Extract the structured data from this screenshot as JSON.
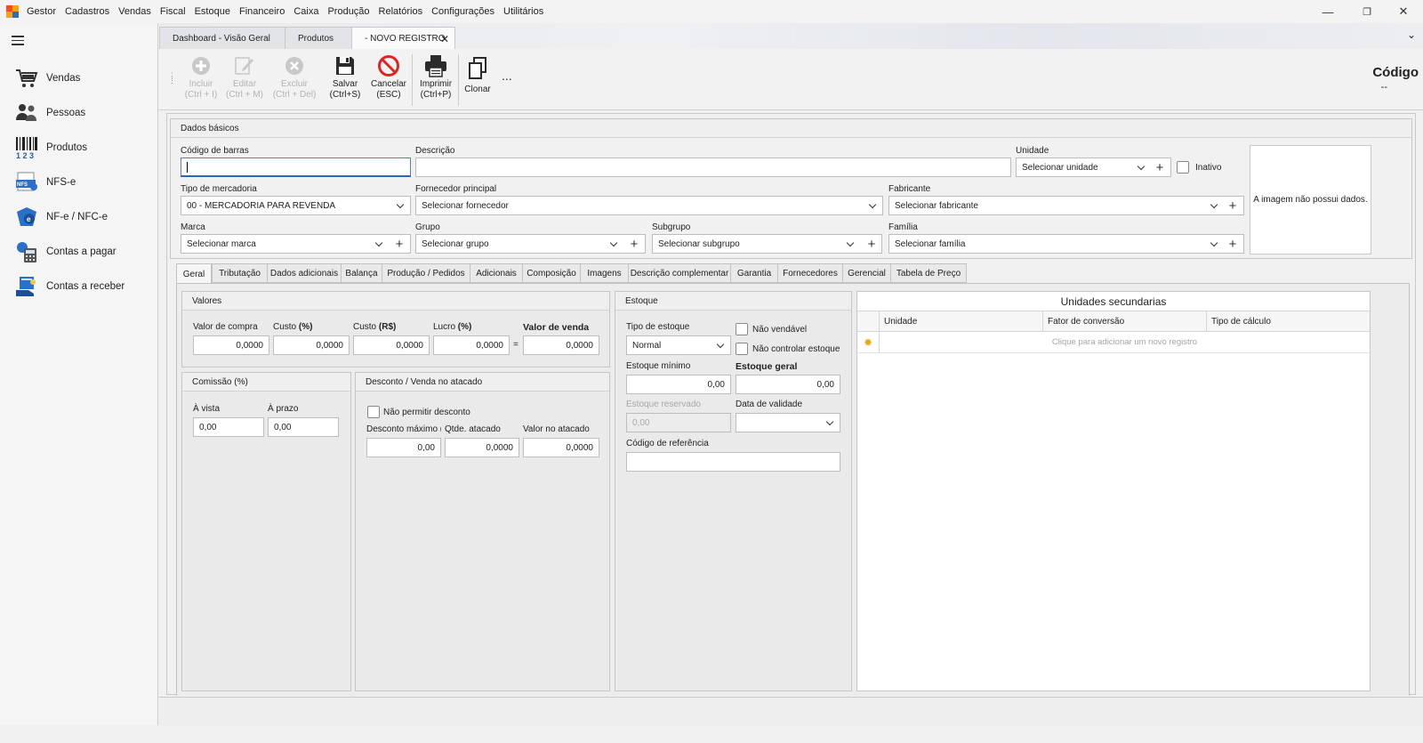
{
  "menubar": {
    "items": [
      "Gestor",
      "Cadastros",
      "Vendas",
      "Fiscal",
      "Estoque",
      "Financeiro",
      "Caixa",
      "Produção",
      "Relatórios",
      "Configurações",
      "Utilitários"
    ],
    "minimize": "—",
    "restore": "❐",
    "close": "✕"
  },
  "sidebar": {
    "items": [
      {
        "label": "Vendas",
        "icon": "cart-icon"
      },
      {
        "label": "Pessoas",
        "icon": "people-icon"
      },
      {
        "label": "Produtos",
        "icon": "barcode-icon"
      },
      {
        "label": "NFS-e",
        "icon": "nfse-icon"
      },
      {
        "label": "NF-e / NFC-e",
        "icon": "nfe-icon"
      },
      {
        "label": "Contas a pagar",
        "icon": "calculator-icon"
      },
      {
        "label": "Contas a receber",
        "icon": "receive-icon"
      }
    ]
  },
  "tabs": [
    {
      "label": "Dashboard - Visão Geral"
    },
    {
      "label": "Produtos"
    },
    {
      "label": "- NOVO REGISTRO"
    }
  ],
  "toolbar": {
    "incluir": [
      "Incluir",
      "(Ctrl + I)"
    ],
    "editar": [
      "Editar",
      "(Ctrl + M)"
    ],
    "excluir": [
      "Excluir",
      "(Ctrl + Del)"
    ],
    "salvar": [
      "Salvar",
      "(Ctrl+S)"
    ],
    "cancelar": [
      "Cancelar",
      "(ESC)"
    ],
    "imprimir": [
      "Imprimir",
      "(Ctrl+P)"
    ],
    "clonar": "Clonar",
    "more": "...",
    "code_title": "Código",
    "code_value": "--"
  },
  "basic": {
    "title": "Dados básicos",
    "barcode_label": "Código de barras",
    "barcode_value": "",
    "desc_label": "Descrição",
    "desc_value": "",
    "unit_label": "Unidade",
    "unit_value": "Selecionar unidade",
    "inactive_label": "Inativo",
    "type_label": "Tipo de mercadoria",
    "type_value": "00 - MERCADORIA PARA REVENDA",
    "supplier_label": "Fornecedor principal",
    "supplier_value": "Selecionar fornecedor",
    "maker_label": "Fabricante",
    "maker_value": "Selecionar fabricante",
    "brand_label": "Marca",
    "brand_value": "Selecionar marca",
    "group_label": "Grupo",
    "group_value": "Selecionar grupo",
    "subgroup_label": "Subgrupo",
    "subgroup_value": "Selecionar subgrupo",
    "family_label": "Família",
    "family_value": "Selecionar família",
    "image_text": "A imagem não possui dados."
  },
  "subtabs": [
    "Geral",
    "Tributação",
    "Dados adicionais",
    "Balança",
    "Produção / Pedidos",
    "Adicionais",
    "Composição",
    "Imagens",
    "Descrição complementar",
    "Garantia",
    "Fornecedores",
    "Gerencial",
    "Tabela de Preço"
  ],
  "valores": {
    "title": "Valores",
    "compra_label": "Valor de compra",
    "compra": "0,0000",
    "custo_pct_label": "Custo",
    "custo_pct_unit": "(%)",
    "custo_pct": "0,0000",
    "custo_rs_label": "Custo",
    "custo_rs_unit": "(R$)",
    "custo_rs": "0,0000",
    "lucro_label": "Lucro",
    "lucro_unit": "(%)",
    "lucro": "0,0000",
    "eq": "=",
    "venda_label": "Valor de venda",
    "venda": "0,0000"
  },
  "comissao": {
    "title": "Comissão (%)",
    "vista_label": "À vista",
    "vista": "0,00",
    "prazo_label": "À prazo",
    "prazo": "0,00"
  },
  "desconto": {
    "title": "Desconto / Venda no atacado",
    "nao_permitir": "Não permitir desconto",
    "max_label": "Desconto máximo (%",
    "max": "0,00",
    "qtde_label": "Qtde. atacado",
    "qtde": "0,0000",
    "valor_label": "Valor no atacado",
    "valor": "0,0000"
  },
  "estoque": {
    "title": "Estoque",
    "tipo_label": "Tipo de estoque",
    "tipo": "Normal",
    "nao_vendavel": "Não vendável",
    "nao_controlar": "Não controlar estoque",
    "minimo_label": "Estoque mínimo",
    "minimo": "0,00",
    "geral_label": "Estoque geral",
    "geral": "0,00",
    "reservado_label": "Estoque reservado",
    "reservado": "0,00",
    "validade_label": "Data de validade",
    "validade": "",
    "referencia_label": "Código de referência",
    "referencia": ""
  },
  "unidades": {
    "title": "Unidades secundarias",
    "columns": [
      "Unidade",
      "Fator de conversão",
      "Tipo de cálculo"
    ],
    "new_row": "Clique para adicionar um novo registro"
  }
}
